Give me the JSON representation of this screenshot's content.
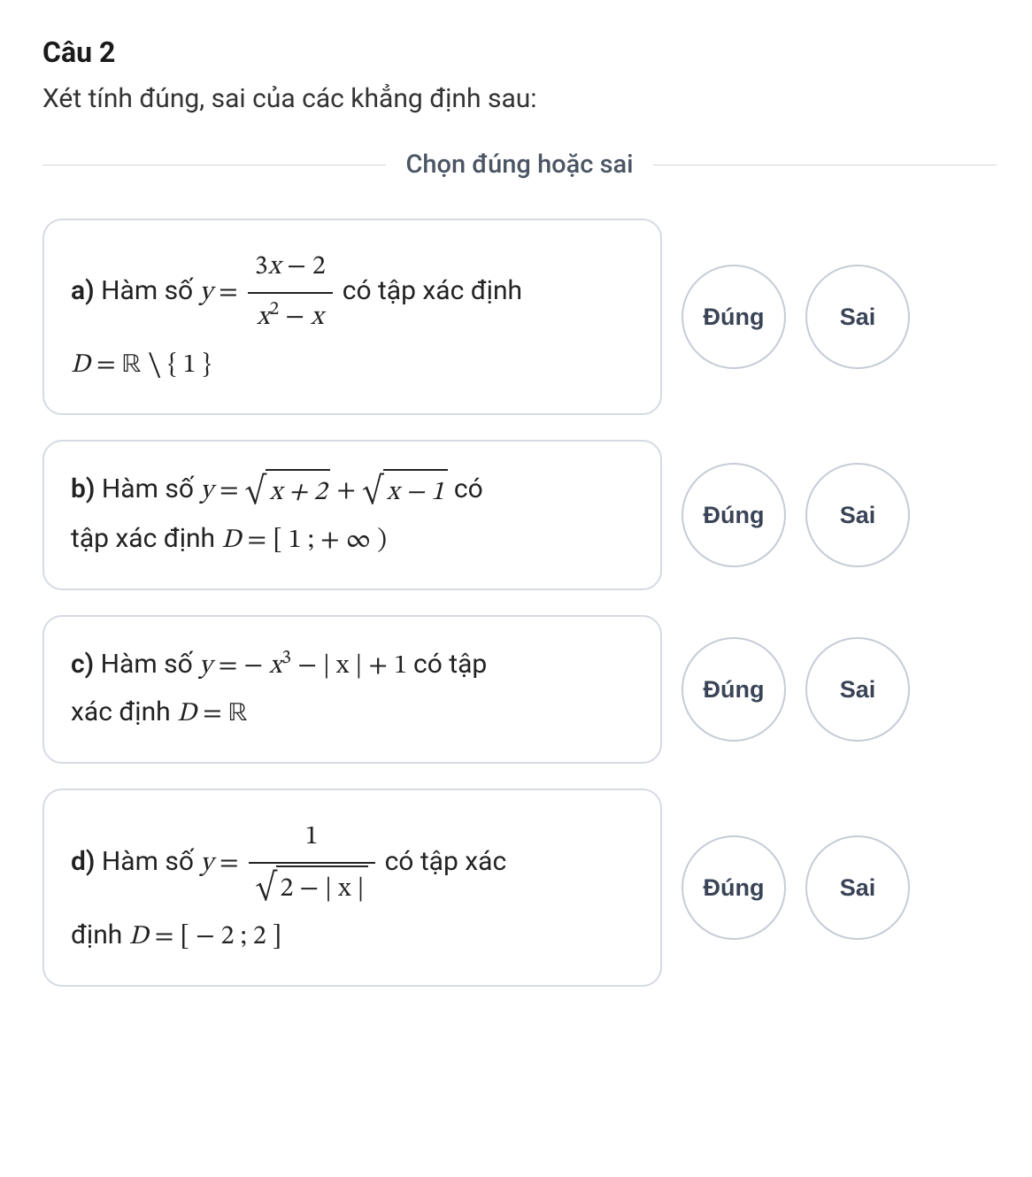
{
  "question": {
    "title": "Câu 2",
    "prompt": "Xét tính đúng, sai của các khẳng định sau:"
  },
  "divider_label": "Chọn đúng hoặc sai",
  "buttons": {
    "true_label": "Đúng",
    "false_label": "Sai"
  },
  "items": {
    "a": {
      "label": "a)",
      "text_prefix": "Hàm số",
      "func_lhs": "y",
      "eq": "=",
      "frac_num_a": "3",
      "frac_num_x": "x",
      "frac_num_minus": "−",
      "frac_num_b": "2",
      "frac_den_x": "x",
      "frac_den_exp": "2",
      "frac_den_minus": "−",
      "frac_den_x2": "x",
      "text_mid": "có tập xác định",
      "domain_D": "D",
      "domain_eq": "=",
      "domain_R": "ℝ",
      "domain_setminus": "∖",
      "domain_set": "{ 1 }"
    },
    "b": {
      "label": "b)",
      "text_prefix": "Hàm số",
      "y": "y",
      "eq": "=",
      "sqrt1_body": "x + 2",
      "plus": "+",
      "sqrt2_body": "x − 1",
      "text_suffix": "có",
      "line2_prefix": "tập xác định",
      "D": "D",
      "deq": "=",
      "interval": "[ 1 ; + ∞ )"
    },
    "c": {
      "label": "c)",
      "text_prefix": "Hàm số",
      "y": "y",
      "eq": "=",
      "neg": "−",
      "x": "x",
      "exp": "3",
      "minus": "−",
      "abs": "| x |",
      "plus": "+",
      "one": "1",
      "text_suffix": "có tập",
      "line2_prefix": "xác định",
      "D": "D",
      "deq": "=",
      "R": "ℝ"
    },
    "d": {
      "label": "d)",
      "text_prefix": "Hàm số",
      "y": "y",
      "eq": "=",
      "num": "1",
      "den_inner": "2 − | x |",
      "text_suffix": "có tập xác",
      "line2_prefix": "định",
      "D": "D",
      "deq": "=",
      "interval": "[ − 2 ; 2 ]"
    }
  }
}
